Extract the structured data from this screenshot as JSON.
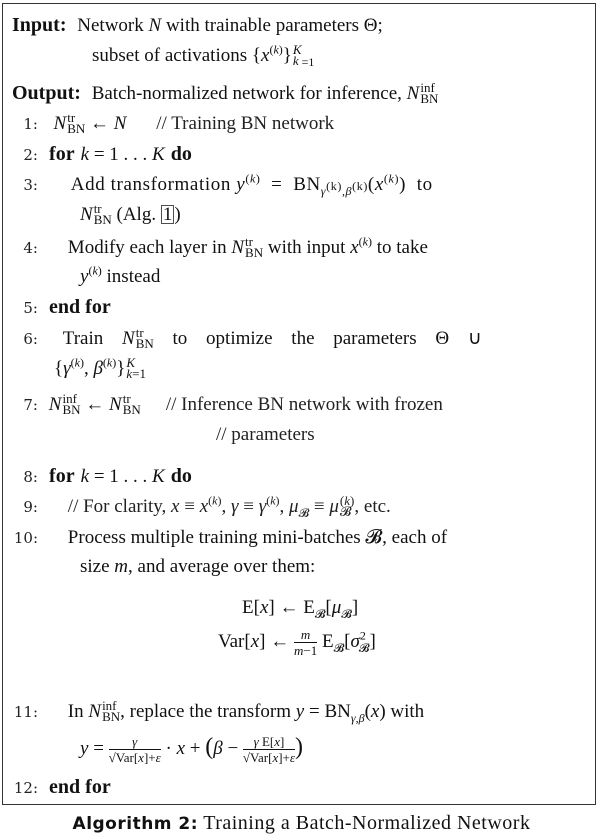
{
  "algorithm": {
    "input_label": "Input:",
    "input_text_1": "Network N with trainable parameters Θ;",
    "input_text_2": "subset of activations {x(k)} k=1..K",
    "output_label": "Output:",
    "output_text": "Batch-normalized network for inference, N_BN^inf",
    "lines": [
      {
        "num": "1:",
        "text": "N_BN^tr ← N",
        "comment": "// Training BN network"
      },
      {
        "num": "2:",
        "keyword": "for",
        "text": "k = 1 . . . K",
        "keyword_end": "do"
      },
      {
        "num": "3:",
        "text": "Add transformation y(k) = BN γ(k),β(k) (x(k)) to",
        "cont": "N_BN^tr (Alg. 1)",
        "ref": "1"
      },
      {
        "num": "4:",
        "text": "Modify each layer in N_BN^tr with input x(k) to take",
        "cont": "y(k) instead"
      },
      {
        "num": "5:",
        "keyword": "end for"
      },
      {
        "num": "6:",
        "text": "Train N_BN^tr to optimize the parameters Θ ∪",
        "cont": "{γ(k), β(k)} k=1..K"
      },
      {
        "num": "7:",
        "text": "N_BN^inf ← N_BN^tr",
        "comment": "// Inference BN network with frozen",
        "comment_cont": "// parameters"
      },
      {
        "num": "8:",
        "keyword": "for",
        "text": "k = 1 . . . K",
        "keyword_end": "do"
      },
      {
        "num": "9:",
        "comment": "// For clarity, x ≡ x(k), γ ≡ γ(k), μB ≡ μB(k), etc."
      },
      {
        "num": "10:",
        "text": "Process multiple training mini-batches B, each of",
        "cont": "size m, and average over them:"
      },
      {
        "num": "eq1",
        "text": "E[x] ← E_B[μ_B]"
      },
      {
        "num": "eq2",
        "text": "Var[x] ← m/(m−1) E_B[σ_B²]"
      },
      {
        "num": "11:",
        "text": "In N_BN^inf, replace the transform y = BN γ,β (x) with",
        "cont": "y = γ/√(Var[x]+ε) · x + (β − γE[x]/√(Var[x]+ε))"
      },
      {
        "num": "12:",
        "keyword": "end for"
      }
    ],
    "caption_label": "Algorithm 2:",
    "caption_text": "Training a Batch-Normalized Network",
    "ref_box_color": "#e01010"
  }
}
